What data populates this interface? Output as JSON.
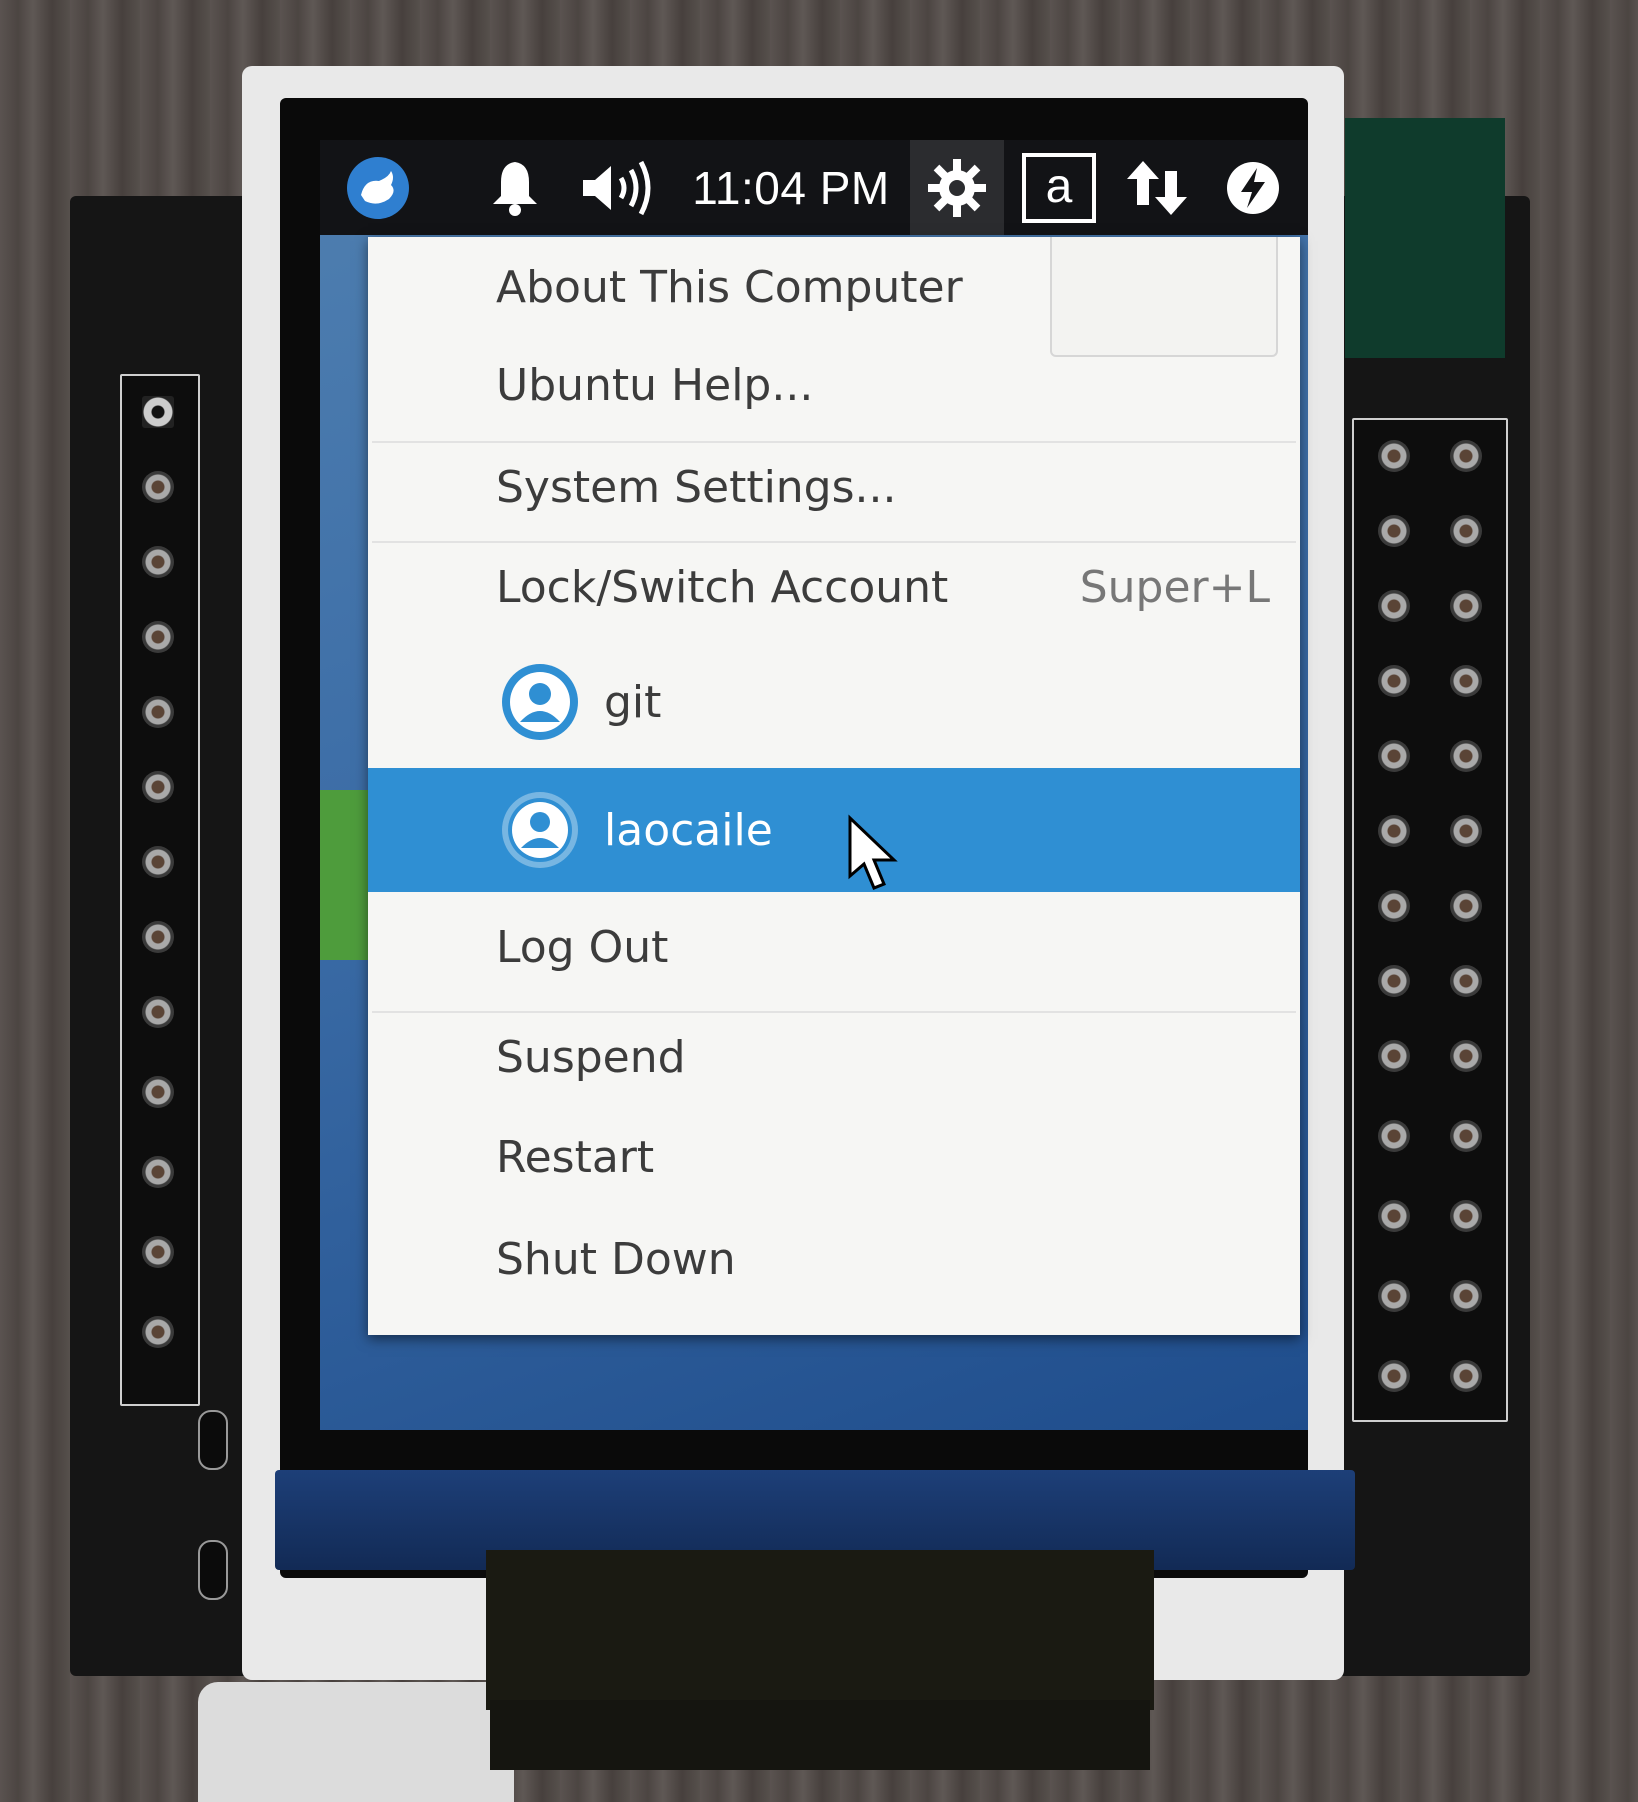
{
  "topbar": {
    "time": "11:04 PM",
    "keyboard_layout": "a",
    "icons": [
      "ubuntu-logo-icon",
      "bell-icon",
      "volume-icon",
      "gear-icon",
      "keyboard-icon",
      "network-icon",
      "power-icon"
    ]
  },
  "menu": {
    "items": [
      {
        "label": "About This Computer"
      },
      {
        "label": "Ubuntu Help..."
      },
      {
        "label": "System Settings..."
      },
      {
        "label": "Lock/Switch Account",
        "shortcut": "Super+L"
      },
      {
        "label": "git"
      },
      {
        "label": "laocaile",
        "active": true
      },
      {
        "label": "Log Out"
      },
      {
        "label": "Suspend"
      },
      {
        "label": "Restart"
      },
      {
        "label": "Shut Down"
      }
    ]
  },
  "colors": {
    "highlight": "#2f8fd3",
    "topbar": "#121316",
    "menu_bg": "#f6f6f4",
    "avatar": "#2f8fd3"
  }
}
